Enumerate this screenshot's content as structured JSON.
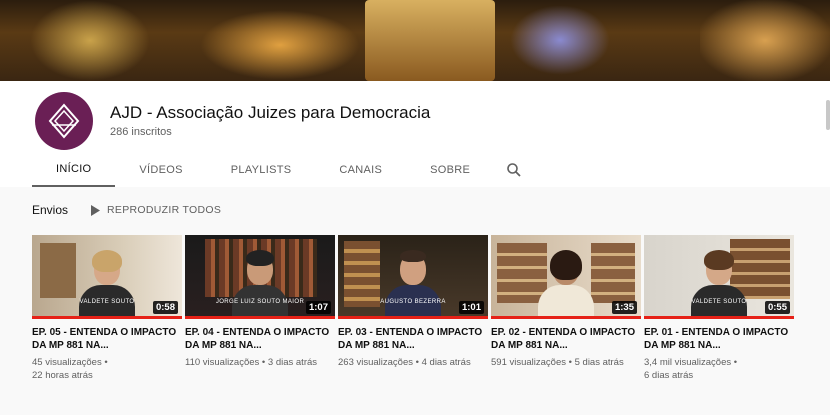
{
  "channel": {
    "name": "AJD - Associação Juizes para Democracia",
    "subscribers": "286 inscritos"
  },
  "tabs": [
    {
      "label": "INÍCIO",
      "active": true
    },
    {
      "label": "VÍDEOS"
    },
    {
      "label": "PLAYLISTS"
    },
    {
      "label": "CANAIS"
    },
    {
      "label": "SOBRE"
    }
  ],
  "section": {
    "title": "Envios",
    "play_all": "REPRODUZIR TODOS"
  },
  "videos": [
    {
      "title": "EP. 05 - ENTENDA O IMPACTO DA MP 881 NA...",
      "duration": "0:58",
      "views": "45 visualizações",
      "age": "22 horas atrás",
      "caption": "VALDETE SOUTO"
    },
    {
      "title": "EP. 04 - ENTENDA O IMPACTO DA MP 881 NA...",
      "duration": "1:07",
      "views": "110 visualizações",
      "age": "3 dias atrás",
      "caption": "JORGE LUIZ SOUTO MAIOR"
    },
    {
      "title": "EP. 03 - ENTENDA O IMPACTO DA MP 881 NA...",
      "duration": "1:01",
      "views": "263 visualizações",
      "age": "4 dias atrás",
      "caption": "AUGUSTO BEZERRA"
    },
    {
      "title": "EP. 02 - ENTENDA O IMPACTO DA MP 881 NA...",
      "duration": "1:35",
      "views": "591 visualizações",
      "age": "5 dias atrás",
      "caption": ""
    },
    {
      "title": "EP. 01 - ENTENDA O IMPACTO DA MP 881 NA...",
      "duration": "0:55",
      "views": "3,4 mil visualizações",
      "age": "6 dias atrás",
      "caption": "VALDETE SOUTO"
    }
  ],
  "colors": {
    "avatar_bg": "#6a1f55",
    "progress_red": "#e62117"
  }
}
